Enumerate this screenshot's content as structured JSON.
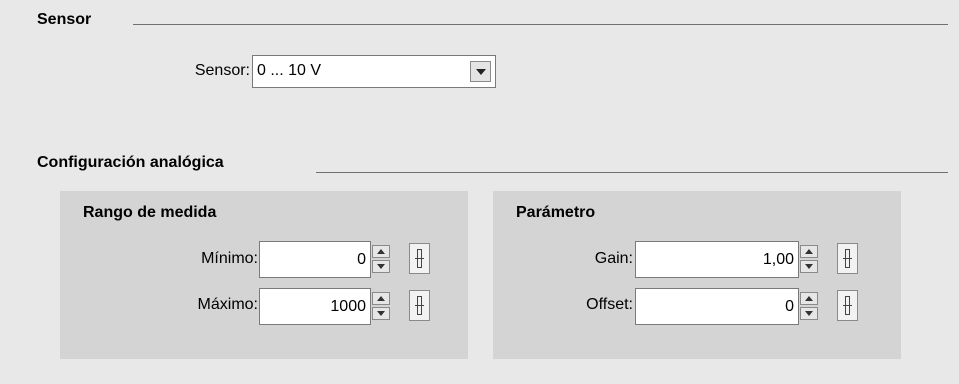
{
  "sensor_section": {
    "title": "Sensor",
    "sensor_label": "Sensor:",
    "sensor_value": "0 ... 10 V"
  },
  "analog_section": {
    "title": "Configuración analógica",
    "range_panel": {
      "title": "Rango de medida",
      "min_label": "Mínimo:",
      "min_value": "0",
      "max_label": "Máximo:",
      "max_value": "1000"
    },
    "param_panel": {
      "title": "Parámetro",
      "gain_label": "Gain:",
      "gain_value": "1,00",
      "offset_label": "Offset:",
      "offset_value": "0"
    }
  },
  "icons": {
    "dropdown": "chevron-down-icon",
    "spin_up": "spin-up-icon",
    "spin_down": "spin-down-icon",
    "slider": "slider-icon"
  }
}
